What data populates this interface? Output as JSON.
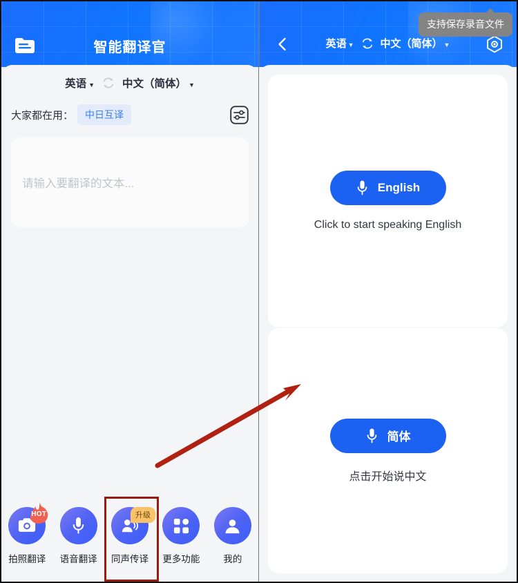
{
  "left_panel": {
    "header": {
      "title": "智能翻译官",
      "folder_icon": "folder-document-icon"
    },
    "language_bar": {
      "source": "英语",
      "target": "中文（简体）",
      "caret": "▼",
      "swap_icon": "swap-arrows-icon"
    },
    "popular": {
      "label": "大家都在用：",
      "chip": "中日互译",
      "settings_icon": "sliders-settings-icon"
    },
    "text_input": {
      "placeholder": "请输入要翻译的文本..."
    },
    "tabbar": [
      {
        "label": "拍照翻译",
        "icon": "camera-icon",
        "badge": "HOT",
        "badge_type": "flame"
      },
      {
        "label": "语音翻译",
        "icon": "microphone-icon",
        "badge": null,
        "badge_type": null
      },
      {
        "label": "同声传译",
        "icon": "person-speaking-icon",
        "badge": "升级",
        "badge_type": "tag",
        "highlighted": true
      },
      {
        "label": "更多功能",
        "icon": "grid-apps-icon",
        "badge": null,
        "badge_type": null
      },
      {
        "label": "我的",
        "icon": "person-profile-icon",
        "badge": null,
        "badge_type": null
      }
    ]
  },
  "right_panel": {
    "header": {
      "back_icon": "chevron-left-icon",
      "source": "英语",
      "target": "中文（简体）",
      "caret": "▼",
      "swap_icon": "swap-arrows-icon",
      "gear_icon": "hex-gear-icon"
    },
    "tooltip": "支持保存录音文件",
    "cards": [
      {
        "button_label": "English",
        "button_icon": "microphone-icon",
        "hint": "Click to start speaking English"
      },
      {
        "button_label": "简体",
        "button_icon": "microphone-icon",
        "hint": "点击开始说中文"
      }
    ]
  },
  "colors": {
    "header_blue": "#1677ff",
    "pill_blue": "#1b61f2",
    "chip_bg": "#e3ebfb",
    "chip_text": "#3b7ff0",
    "badge_amber": "#f9c269",
    "annotation_red": "#9a1b10",
    "panel_bg": "#f4f5f7"
  }
}
